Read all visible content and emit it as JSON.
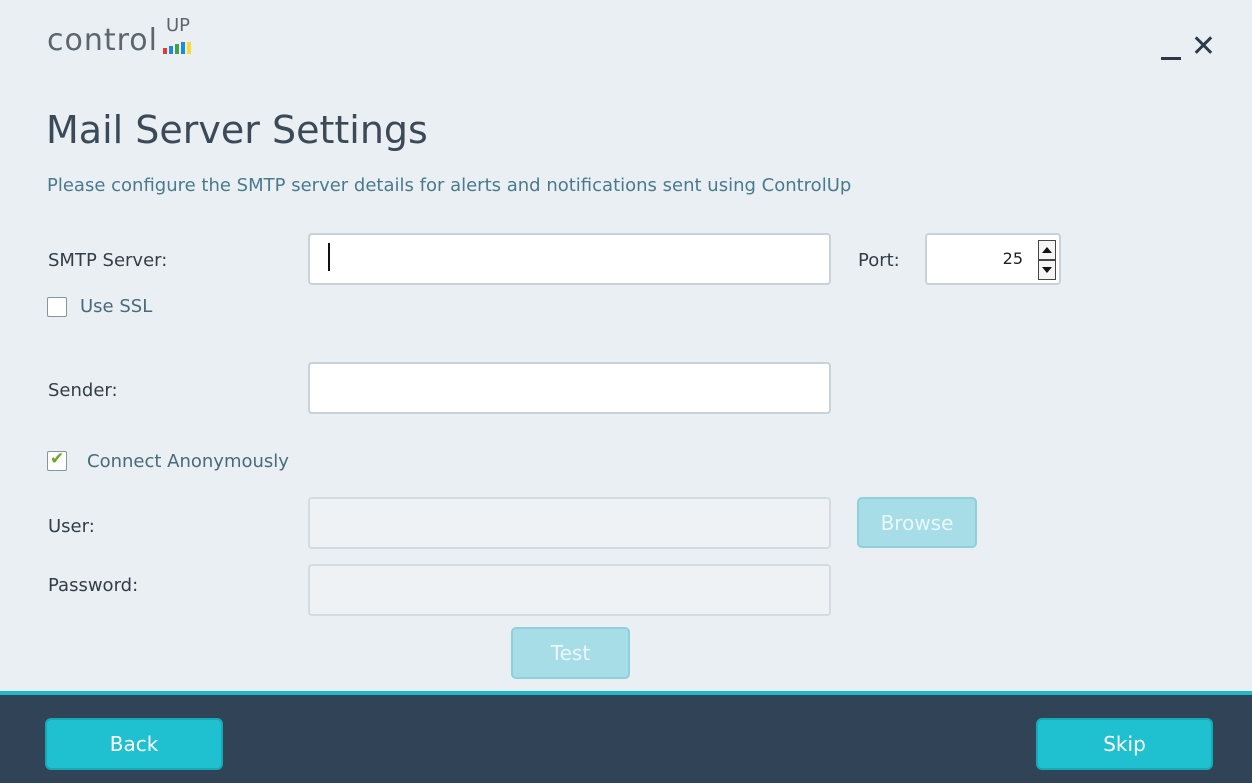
{
  "app": {
    "logo_text": "control",
    "logo_superscript": "UP",
    "logo_bar_colors": [
      "#e53935",
      "#1e88e5",
      "#43a047",
      "#1e88e5",
      "#fdd835"
    ]
  },
  "window_controls": {
    "minimize_label": "_",
    "close_label": "✕"
  },
  "page": {
    "title": "Mail Server Settings",
    "subtitle": "Please configure the SMTP server details for alerts and notifications sent using ControlUp"
  },
  "form": {
    "smtp_server_label": "SMTP Server:",
    "smtp_server_value": "",
    "port_label": "Port:",
    "port_value": "25",
    "use_ssl_label": "Use SSL",
    "use_ssl_checked": false,
    "sender_label": "Sender:",
    "sender_value": "",
    "connect_anonymously_label": "Connect Anonymously",
    "connect_anonymously_checked": true,
    "user_label": "User:",
    "user_value": "",
    "password_label": "Password:",
    "password_value": "",
    "browse_label": "Browse",
    "test_label": "Test"
  },
  "footer": {
    "back_label": "Back",
    "skip_label": "Skip"
  },
  "colors": {
    "accent": "#1fc0cf",
    "footer_bg": "#314457",
    "check_color": "#6aa825"
  },
  "icons": {
    "check": "✔",
    "spin_up": "triangle-up",
    "spin_down": "triangle-down"
  }
}
